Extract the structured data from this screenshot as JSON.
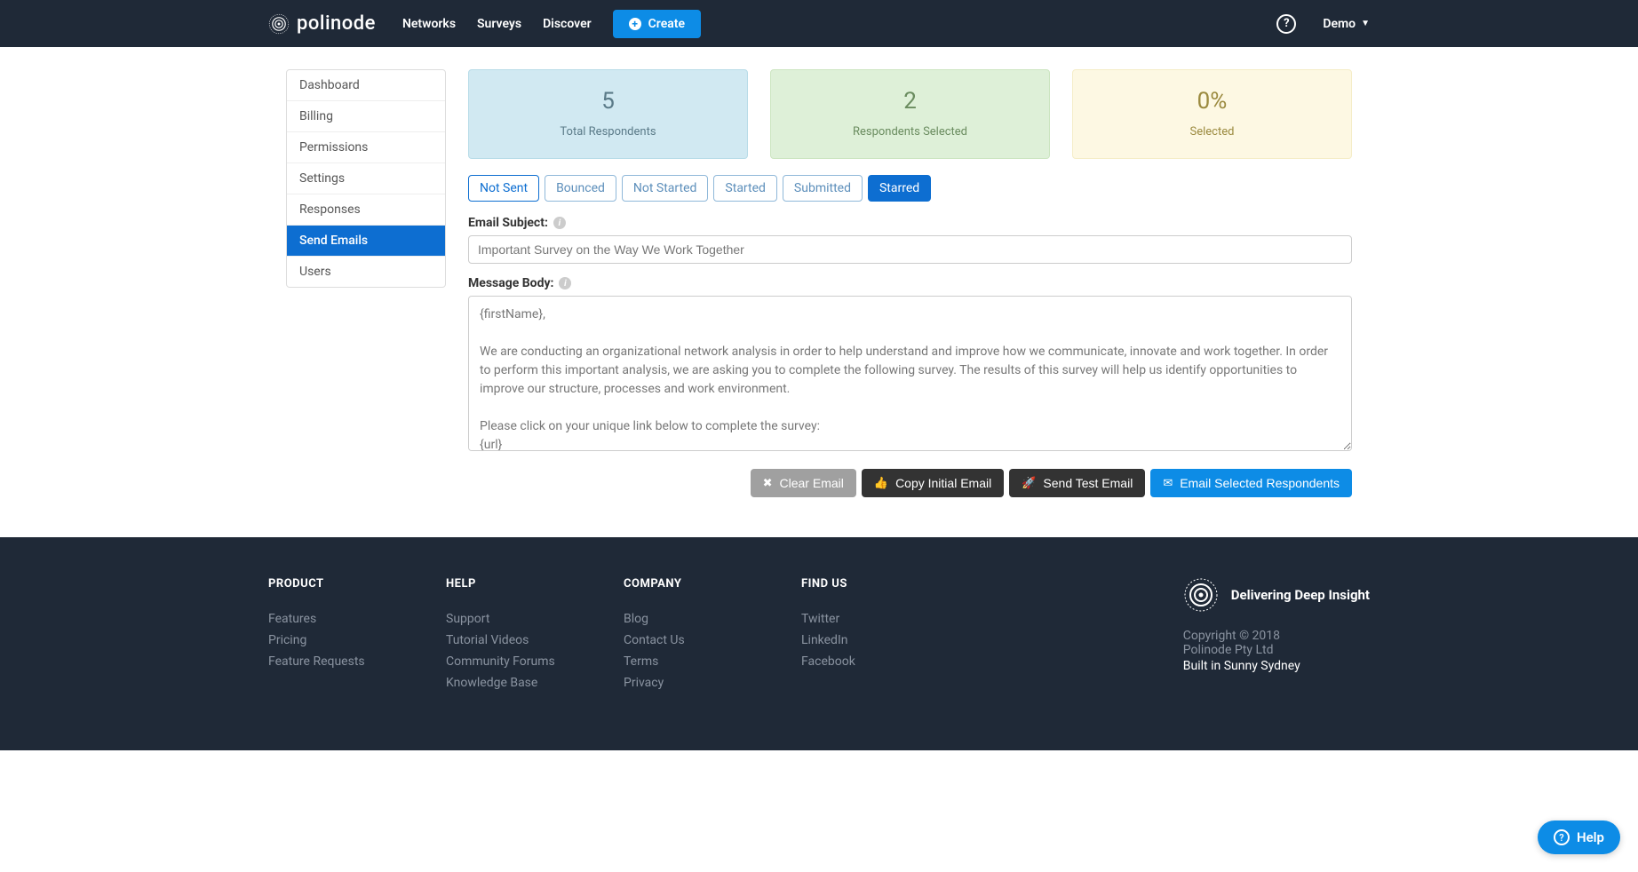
{
  "header": {
    "brand": "polinode",
    "nav": [
      "Networks",
      "Surveys",
      "Discover"
    ],
    "create": "Create",
    "user": "Demo"
  },
  "sidebar": {
    "items": [
      "Dashboard",
      "Billing",
      "Permissions",
      "Settings",
      "Responses",
      "Send Emails",
      "Users"
    ],
    "active_index": 5
  },
  "stats": [
    {
      "value": "5",
      "label": "Total Respondents",
      "cls": "blue"
    },
    {
      "value": "2",
      "label": "Respondents Selected",
      "cls": "green"
    },
    {
      "value": "0%",
      "label": "Selected",
      "cls": "yellow"
    }
  ],
  "filters": {
    "tabs": [
      "Not Sent",
      "Bounced",
      "Not Started",
      "Started",
      "Submitted",
      "Starred"
    ],
    "active_index": 5
  },
  "form": {
    "subject_label": "Email Subject:",
    "subject_value": "Important Survey on the Way We Work Together",
    "body_label": "Message Body:",
    "body_value": "{firstName},\n\nWe are conducting an organizational network analysis in order to help understand and improve how we communicate, innovate and work together. In order to perform this important analysis, we are asking you to complete the following survey. The results of this survey will help us identify opportunities to improve our structure, processes and work environment.\n\nPlease click on your unique link below to complete the survey:\n{url}\n\nIn order for the survey to be effective we require that as many people as possible complete it. Completing the survey should only take a few"
  },
  "actions": {
    "clear": "Clear Email",
    "copy": "Copy Initial Email",
    "test": "Send Test Email",
    "send": "Email Selected Respondents"
  },
  "footer": {
    "product_h": "PRODUCT",
    "product": [
      "Features",
      "Pricing",
      "Feature Requests"
    ],
    "help_h": "HELP",
    "help": [
      "Support",
      "Tutorial Videos",
      "Community Forums",
      "Knowledge Base"
    ],
    "company_h": "COMPANY",
    "company": [
      "Blog",
      "Contact Us",
      "Terms",
      "Privacy"
    ],
    "find_h": "FIND US",
    "find": [
      "Twitter",
      "LinkedIn",
      "Facebook"
    ],
    "tagline": "Delivering Deep Insight",
    "copyright": "Copyright © 2018",
    "company_name": "Polinode Pty Ltd",
    "built": "Built in Sunny Sydney"
  },
  "help_widget": "Help"
}
